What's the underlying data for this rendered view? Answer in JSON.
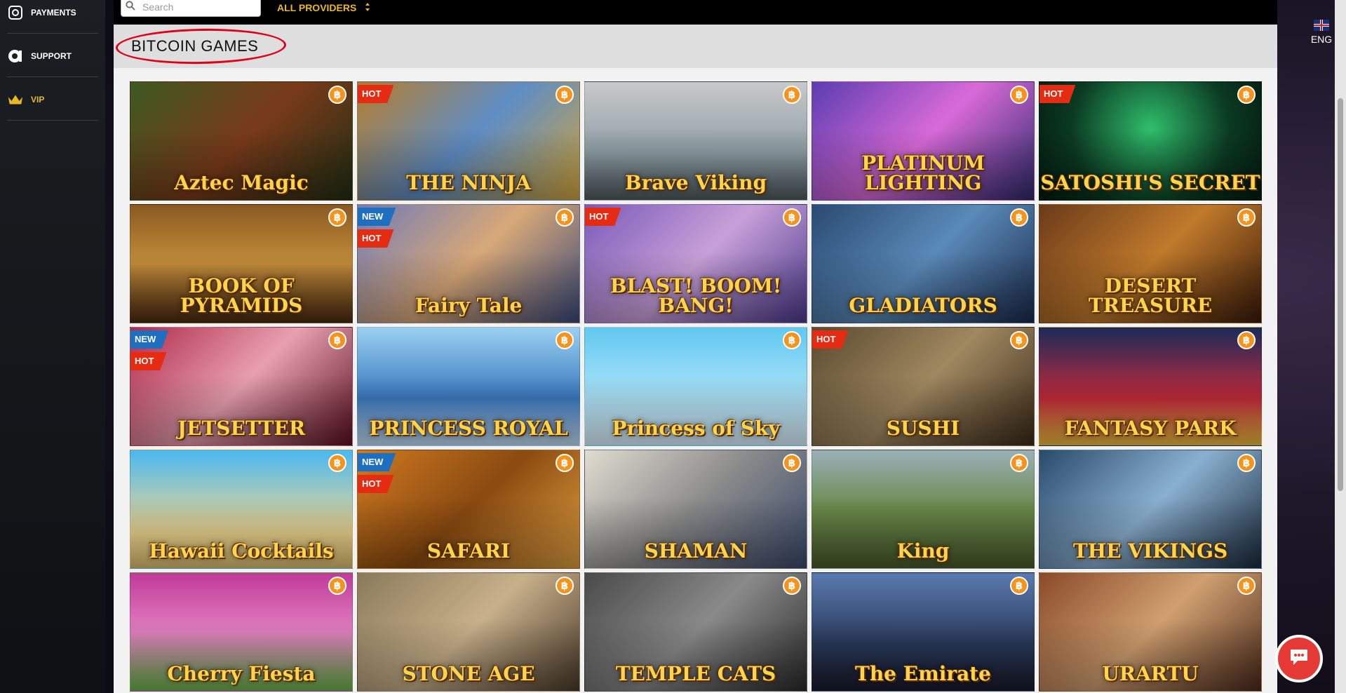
{
  "sidebar": {
    "items": [
      {
        "label": "PAYMENTS",
        "icon": "payments-icon"
      },
      {
        "label": "SUPPORT",
        "icon": "support-icon"
      },
      {
        "label": "VIP",
        "icon": "crown-icon"
      }
    ]
  },
  "topbar": {
    "search_placeholder": "Search",
    "providers_label": "ALL PROVIDERS"
  },
  "section": {
    "title": "BITCOIN GAMES"
  },
  "language": {
    "code": "ENG"
  },
  "colors": {
    "accent": "#e8b924",
    "hot": "#e52b12",
    "new": "#1e6fc0",
    "bitcoin": "#f7931a",
    "chat": "#e53a36"
  },
  "games": [
    {
      "title": "Aztec Magic",
      "badges": [],
      "bg": "linear-gradient(135deg,#3c5a22,#7a3a1a 50%,#1f2f12)"
    },
    {
      "title": "THE NINJA",
      "badges": [
        "HOT"
      ],
      "bg": "linear-gradient(135deg,#b67c2a,#5e8dc4 50%,#d4a63a)"
    },
    {
      "title": "Brave Viking",
      "badges": [],
      "bg": "linear-gradient(180deg,#c9c9c9,#8fa0a8 60%,#4f5a5e)"
    },
    {
      "title": "PLATINUM LIGHTING",
      "badges": [],
      "bg": "linear-gradient(135deg,#5a3db0,#d96ad8 50%,#2b2a6a)"
    },
    {
      "title": "SATOSHI'S SECRET",
      "badges": [
        "HOT"
      ],
      "bg": "radial-gradient(circle at 50% 40%,#2fbf6b,#0b3a22 60%,#041a10)"
    },
    {
      "title": "BOOK OF PYRAMIDS",
      "badges": [],
      "bg": "linear-gradient(180deg,#8a5a22,#c48d3a 50%,#4a2a10)"
    },
    {
      "title": "Fairy Tale",
      "badges": [
        "NEW",
        "HOT"
      ],
      "bg": "linear-gradient(135deg,#6f7bb8,#d8a877 50%,#394a7a)"
    },
    {
      "title": "BLAST! BOOM! BANG!",
      "badges": [
        "HOT"
      ],
      "bg": "linear-gradient(135deg,#7a5ab8,#c8a0d8 50%,#4a3a8a)"
    },
    {
      "title": "GLADIATORS",
      "badges": [],
      "bg": "linear-gradient(135deg,#2a4a72,#5a8ab8 50%,#1a2a4a)"
    },
    {
      "title": "DESERT TREASURE",
      "badges": [],
      "bg": "linear-gradient(135deg,#6a3a1a,#c07a2a 50%,#3a1a0a)"
    },
    {
      "title": "JETSETTER",
      "badges": [
        "NEW",
        "HOT"
      ],
      "bg": "linear-gradient(135deg,#b02a4a,#e8a0b0 50%,#5a1020)"
    },
    {
      "title": "PRINCESS ROYAL",
      "badges": [],
      "bg": "linear-gradient(180deg,#9ad0f0,#3a7ac0 60%,#c8e0f8)"
    },
    {
      "title": "Princess of Sky",
      "badges": [],
      "bg": "linear-gradient(180deg,#60c8f0,#a0e0f8 50%,#e0f4ff)"
    },
    {
      "title": "SUSHI",
      "badges": [
        "HOT"
      ],
      "bg": "linear-gradient(135deg,#5a4a30,#a08860 50%,#3a2a18)"
    },
    {
      "title": "FANTASY PARK",
      "badges": [],
      "bg": "linear-gradient(180deg,#1a2a5a,#c02a3a 60%,#f0c040)"
    },
    {
      "title": "Hawaii Cocktails",
      "badges": [],
      "bg": "linear-gradient(180deg,#4ab8f0,#f0d890 70%,#e0c070)"
    },
    {
      "title": "SAFARI",
      "badges": [
        "NEW",
        "HOT"
      ],
      "bg": "linear-gradient(135deg,#d07a20,#8a4a10 50%,#e0a040)"
    },
    {
      "title": "SHAMAN",
      "badges": [],
      "bg": "linear-gradient(135deg,#e0dcd0,#8a8a8a 50%,#3a4a6a)"
    },
    {
      "title": "King",
      "badges": [],
      "bg": "linear-gradient(180deg,#9ab0b8,#6a8a4a 50%,#4a5a2a)"
    },
    {
      "title": "THE VIKINGS",
      "badges": [],
      "bg": "linear-gradient(135deg,#2a4a6a,#8ab0d0 50%,#1a2a3a)"
    },
    {
      "title": "Cherry Fiesta",
      "badges": [],
      "bg": "linear-gradient(180deg,#c03a9a,#e080c0 50%,#6ab84a)"
    },
    {
      "title": "STONE AGE",
      "badges": [],
      "bg": "linear-gradient(135deg,#8a7a5a,#c8b08a 50%,#4a3a2a)"
    },
    {
      "title": "TEMPLE CATS",
      "badges": [],
      "bg": "linear-gradient(135deg,#4a4a4a,#8a8a8a 50%,#2a2a2a)"
    },
    {
      "title": "The Emirate",
      "badges": [],
      "bg": "linear-gradient(180deg,#5a7ab0,#2a3a5a 60%,#1a1a2a)"
    },
    {
      "title": "URARTU",
      "badges": [],
      "bg": "linear-gradient(135deg,#8a4a2a,#d0a070 50%,#4a2a1a)"
    }
  ]
}
